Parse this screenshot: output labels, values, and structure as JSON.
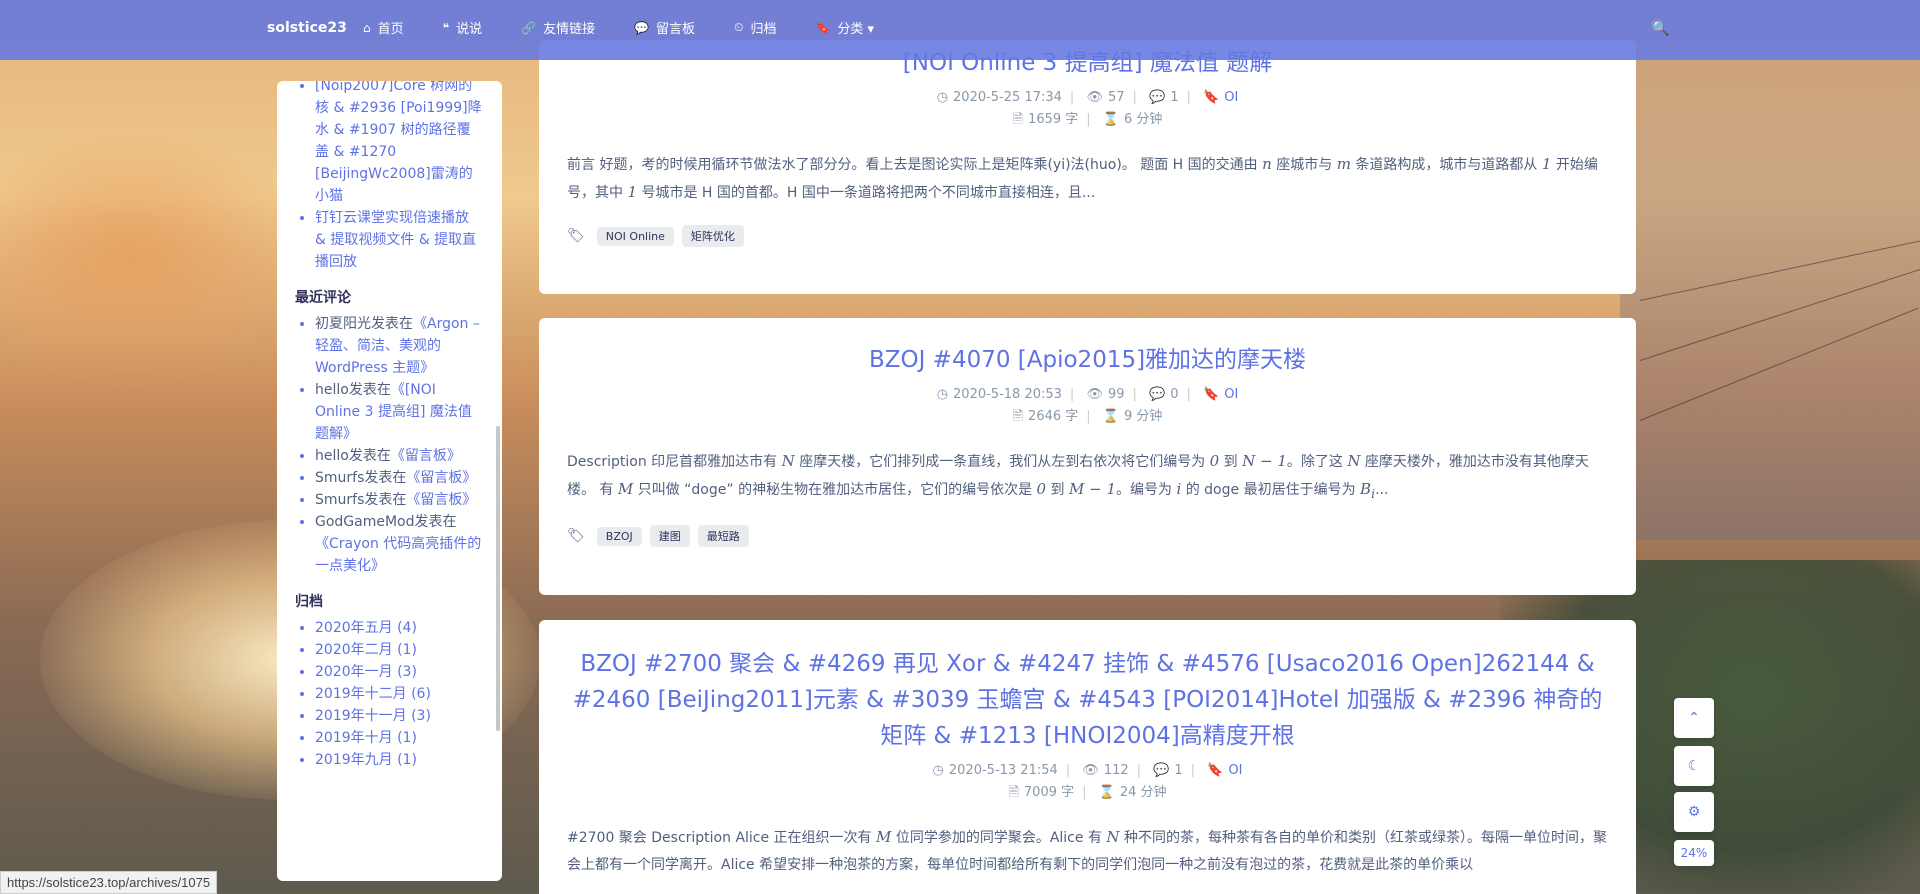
{
  "navbar": {
    "brand": "solstice23",
    "items": [
      {
        "icon": "home-icon",
        "glyph": "⌂",
        "label": "首页"
      },
      {
        "icon": "quote-icon",
        "glyph": "❝",
        "label": "说说"
      },
      {
        "icon": "link-icon",
        "glyph": "🔗",
        "label": "友情链接"
      },
      {
        "icon": "comments-icon",
        "glyph": "💬",
        "label": "留言板"
      },
      {
        "icon": "clock-icon",
        "glyph": "⏲",
        "label": "归档"
      },
      {
        "icon": "bookmark-icon",
        "glyph": "🔖",
        "label": "分类 ▾"
      }
    ],
    "search_glyph": "🔍"
  },
  "sidebar": {
    "top_posts": [
      "[Noip2007]Core 树网的核 & #2936 [Poi1999]降水 & #1907 树的路径覆盖 & #1270 [BeijingWc2008]雷涛的小猫",
      "钉钉云课堂实现倍速播放 & 提取视频文件 & 提取直播回放"
    ],
    "recent_comments_title": "最近评论",
    "recent_comments": [
      {
        "author": "初夏阳光",
        "verb": "发表在",
        "post": "《Argon – 轻盈、简洁、美观的 WordPress 主题》"
      },
      {
        "author": "hello",
        "verb": "发表在",
        "post": "《[NOI Online 3 提高组] 魔法值 题解》"
      },
      {
        "author": "hello",
        "verb": "发表在",
        "post": "《留言板》"
      },
      {
        "author": "Smurfs",
        "verb": "发表在",
        "post": "《留言板》"
      },
      {
        "author": "Smurfs",
        "verb": "发表在",
        "post": "《留言板》"
      },
      {
        "author": "GodGameMod",
        "verb": "发表在",
        "post": "《Crayon 代码高亮插件的一点美化》"
      }
    ],
    "archives_title": "归档",
    "archives": [
      "2020年五月 (4)",
      "2020年二月 (1)",
      "2020年一月 (3)",
      "2019年十二月 (6)",
      "2019年十一月 (3)",
      "2019年十月 (1)",
      "2019年九月 (1)"
    ]
  },
  "posts": [
    {
      "title": "[NOI Online 3 提高组] 魔法值 题解",
      "date": "2020-5-25 17:34",
      "views": "57",
      "comments": "1",
      "category": "OI",
      "words": "1659 字",
      "read_time": "6 分钟",
      "excerpt_html": "前言 好题，考的时候用循环节做法水了部分分。看上去是图论实际上是矩阵乘(yi)法(huo)。 题面 H 国的交通由 <i>n</i> 座城市与 <i>m</i> 条道路构成，城市与道路都从 <i>1</i> 开始编号，其中 <i>1</i> 号城市是 H 国的首都。H 国中一条道路将把两个不同城市直接相连，且...",
      "tags": [
        "NOI Online",
        "矩阵优化"
      ]
    },
    {
      "title": "BZOJ #4070 [Apio2015]雅加达的摩天楼",
      "date": "2020-5-18 20:53",
      "views": "99",
      "comments": "0",
      "category": "OI",
      "words": "2646 字",
      "read_time": "9 分钟",
      "excerpt_html": "Description 印尼首都雅加达市有 <i>N</i> 座摩天楼，它们排列成一条直线，我们从左到右依次将它们编号为 <i>0</i> 到 <i>N − 1</i>。除了这 <i>N</i> 座摩天楼外，雅加达市没有其他摩天楼。 有 <i>M</i> 只叫做 “doge” 的神秘生物在雅加达市居住，它们的编号依次是 <i>0</i> 到 <i>M − 1</i>。编号为 <i>i</i> 的 doge 最初居住于编号为 <i>B<sub>i</sub></i>...",
      "tags": [
        "BZOJ",
        "建图",
        "最短路"
      ]
    },
    {
      "title": "BZOJ #2700 聚会 & #4269 再见 Xor & #4247 挂饰 & #4576 [Usaco2016 Open]262144 & #2460 [BeiJing2011]元素 & #3039 玉蟾宫 & #4543 [POI2014]Hotel 加强版 & #2396 神奇的矩阵 & #1213 [HNOI2004]高精度开根",
      "date": "2020-5-13 21:54",
      "views": "112",
      "comments": "1",
      "category": "OI",
      "words": "7009 字",
      "read_time": "24 分钟",
      "excerpt_html": "#2700 聚会 Description Alice 正在组织一次有 <i>M</i> 位同学参加的同学聚会。Alice 有 <i>N</i> 种不同的茶，每种茶有各自的单价和类别（红茶或绿茶）。每隔一单位时间，聚会上都有一个同学离开。Alice 希望安排一种泡茶的方案，每单位时间都给所有剩下的同学们泡同一种之前没有泡过的茶，花费就是此茶的单价乘以",
      "tags": []
    }
  ],
  "fabs": {
    "top": "⌃",
    "night": "☾",
    "settings": "⚙",
    "progress": "24%"
  },
  "status_url": "https://solstice23.top/archives/1075"
}
